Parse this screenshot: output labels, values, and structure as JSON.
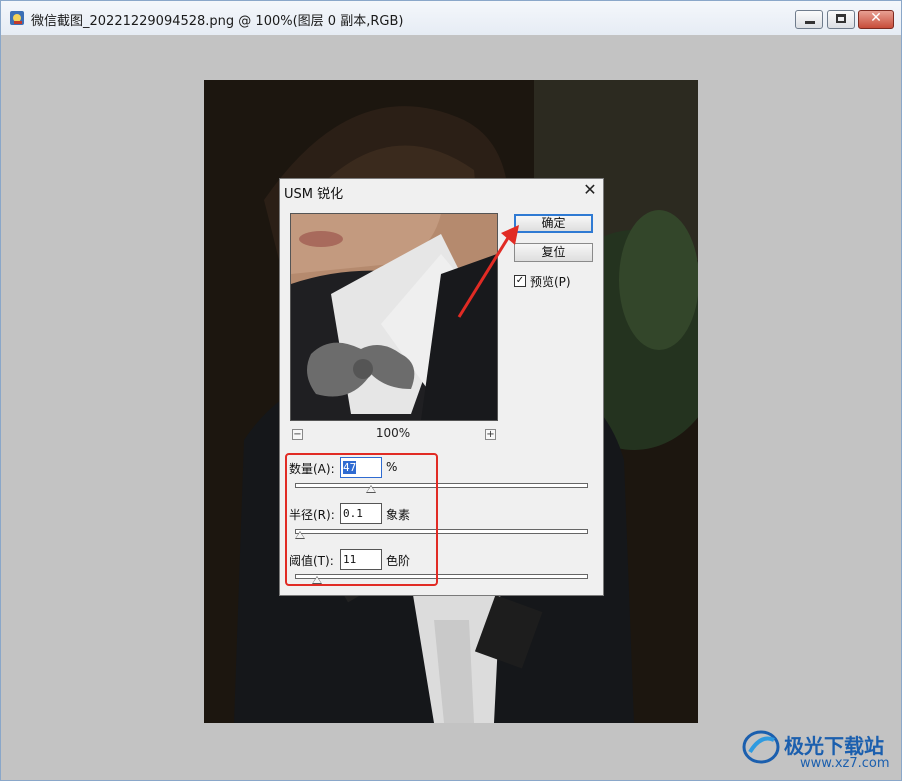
{
  "window": {
    "title": "微信截图_20221229094528.png @ 100%(图层 0 副本,RGB)"
  },
  "dialog": {
    "title": "USM 锐化",
    "close_glyph": "✕",
    "zoom_level": "100%",
    "zoom_out": "−",
    "zoom_in": "+",
    "ok_label": "确定",
    "reset_label": "复位",
    "preview_checked": true,
    "preview_check_glyph": "✓",
    "preview_label": "预览(P)",
    "params": {
      "amount": {
        "label": "数量(A):",
        "value": "47",
        "unit": "%",
        "slider_fraction": 0.25
      },
      "radius": {
        "label": "半径(R):",
        "value": "0.1",
        "unit": "象素",
        "slider_fraction": 0.0
      },
      "threshold": {
        "label": "阈值(T):",
        "value": "11",
        "unit": "色阶",
        "slider_fraction": 0.06
      }
    }
  },
  "watermark": {
    "title": "极光下载站",
    "url": "www.xz7.com"
  },
  "colors": {
    "highlight": "#e12b24",
    "ok_border": "#2f7ad3",
    "watermark": "#1b5fae"
  }
}
